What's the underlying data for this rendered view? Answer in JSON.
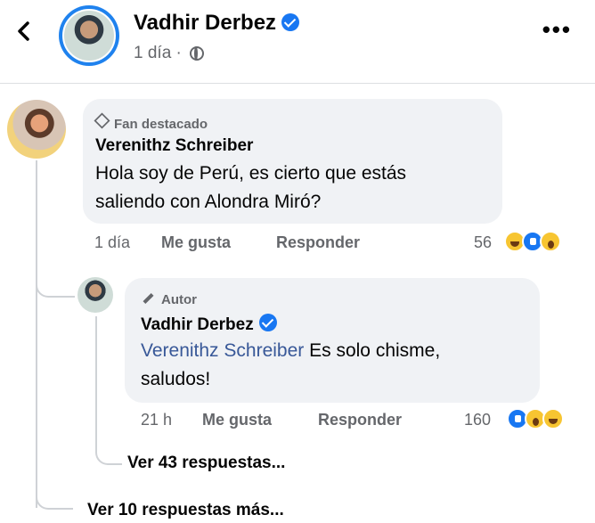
{
  "header": {
    "author_name": "Vadhir Derbez",
    "time": "1 día ·"
  },
  "comment": {
    "badge": "Fan destacado",
    "author": "Verenithz Schreiber",
    "text_line1": "Hola soy de Perú, es cierto que estás",
    "text_line2": "saliendo con Alondra Miró?",
    "time": "1 día",
    "like": "Me gusta",
    "reply": "Responder",
    "reaction_count": "56"
  },
  "reply": {
    "badge": "Autor",
    "author": "Vadhir Derbez",
    "mention": "Verenithz Schreiber",
    "text_line1_rest": " Es solo chisme,",
    "text_line2": "saludos!",
    "time": "21 h",
    "like": "Me gusta",
    "reply": "Responder",
    "reaction_count": "160"
  },
  "view_replies": "Ver 43 respuestas...",
  "view_more": "Ver 10 respuestas más...",
  "reaction_icons": {
    "comment": [
      "haha-icon",
      "like-icon",
      "wow-icon"
    ],
    "reply": [
      "like-icon",
      "wow-icon",
      "haha-icon"
    ]
  }
}
